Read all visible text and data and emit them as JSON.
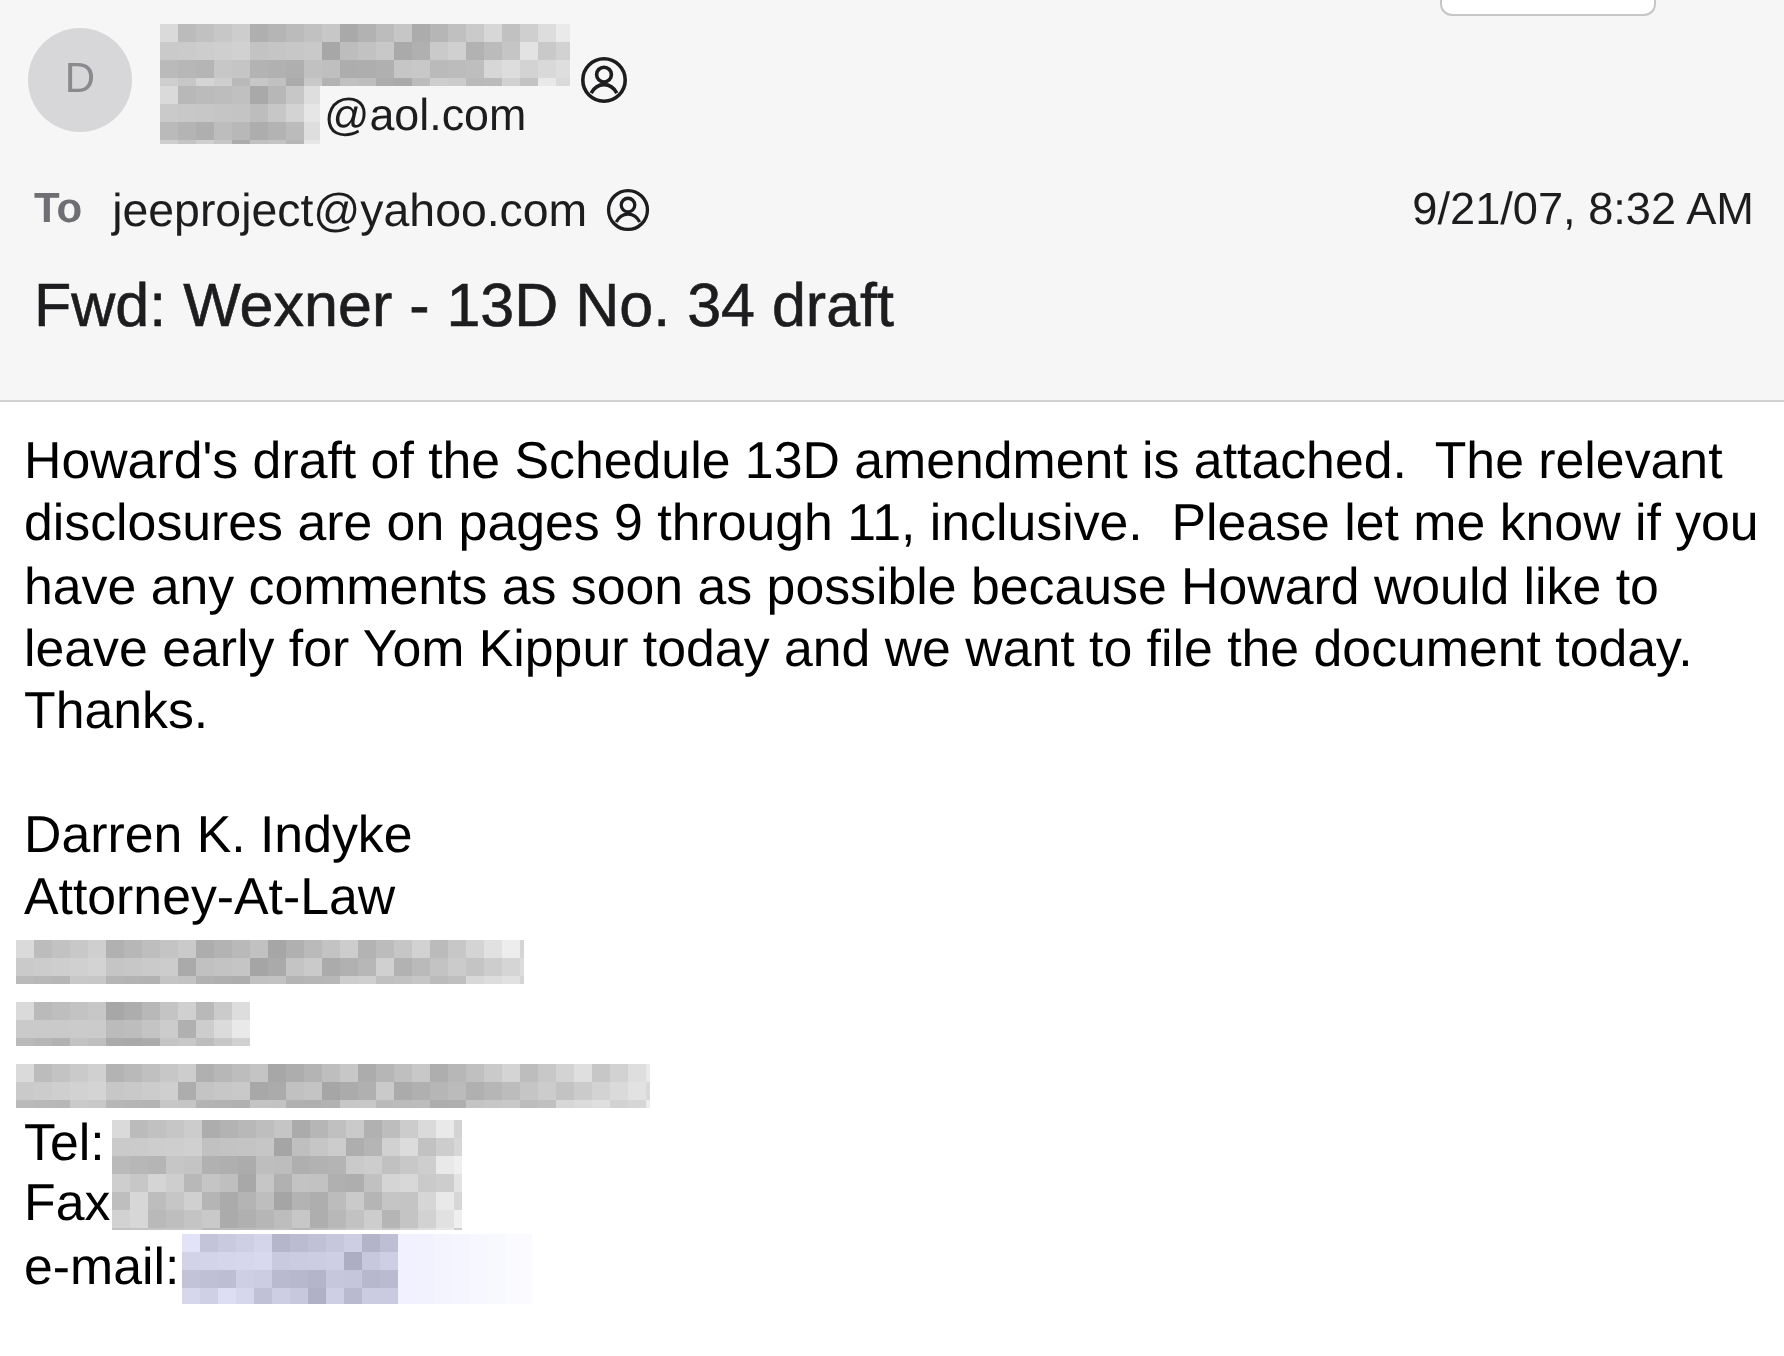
{
  "toolbar": {
    "cut_off_button": true
  },
  "header": {
    "sender": {
      "avatar_initial": "D",
      "name_redacted": true,
      "address": "@aol.com"
    },
    "recipient_label": "To",
    "recipient": "jeeproject@yahoo.com",
    "date": "9/21/07, 8:32 AM",
    "subject": "Fwd: Wexner - 13D No. 34 draft"
  },
  "body": {
    "text": "Howard's draft of the Schedule 13D amendment is attached.  The relevant disclosures are on pages 9 through 11, inclusive.  Please let me know if you have any comments as soon as possible because Howard would like to leave early for Yom Kippur today and we want to file the document today. Thanks.",
    "signature": [
      {
        "kind": "text",
        "text": "Darren K. Indyke"
      },
      {
        "kind": "text",
        "text": "Attorney-At-Law"
      },
      {
        "kind": "redacted"
      },
      {
        "kind": "redacted"
      },
      {
        "kind": "redacted"
      },
      {
        "kind": "contact",
        "labels": [
          "Tel:",
          "Fax"
        ],
        "redacted": true,
        "link": false
      },
      {
        "kind": "contact",
        "labels": [
          "e-mail:"
        ],
        "redacted": true,
        "link": true
      }
    ]
  }
}
